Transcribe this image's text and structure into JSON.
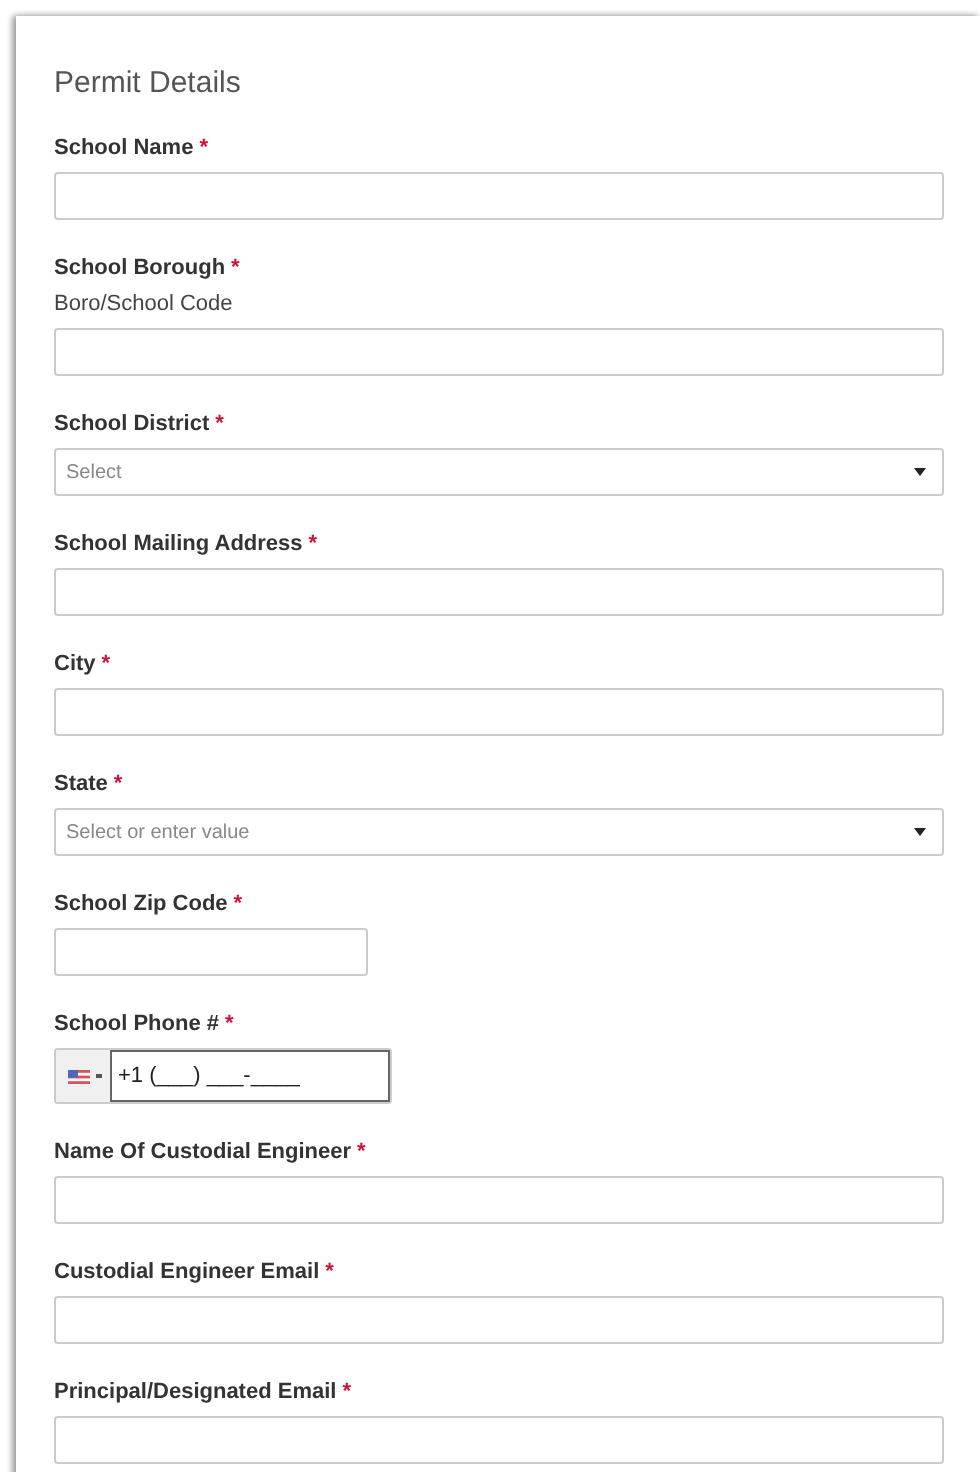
{
  "form": {
    "title": "Permit Details",
    "fields": [
      {
        "kind": "text",
        "label": "School Name",
        "required_mark": "*"
      },
      {
        "kind": "text",
        "label": "School Borough",
        "required_mark": "*",
        "hint": "Boro/School Code"
      },
      {
        "kind": "select",
        "label": "School District",
        "required_mark": "*",
        "placeholder": "Select"
      },
      {
        "kind": "text",
        "label": "School Mailing Address",
        "required_mark": "*"
      },
      {
        "kind": "text",
        "label": "City",
        "required_mark": "*"
      },
      {
        "kind": "select",
        "label": "State",
        "required_mark": "*",
        "placeholder": "Select or enter value"
      },
      {
        "kind": "short",
        "label": "School Zip Code",
        "required_mark": "*"
      },
      {
        "kind": "phone",
        "label": "School Phone #",
        "required_mark": "*",
        "value": "+1 (___) ___-____"
      },
      {
        "kind": "text",
        "label": "Name Of Custodial Engineer",
        "required_mark": "*"
      },
      {
        "kind": "text",
        "label": "Custodial Engineer Email",
        "required_mark": "*"
      },
      {
        "kind": "text",
        "label": "Principal/Designated Email",
        "required_mark": "*"
      }
    ]
  }
}
